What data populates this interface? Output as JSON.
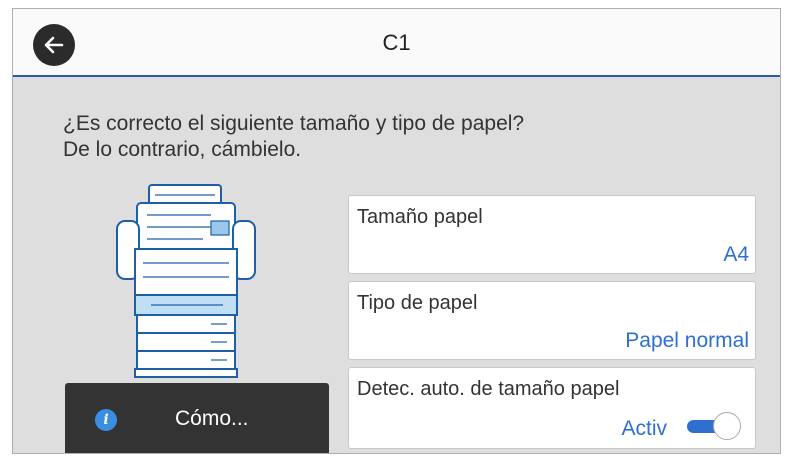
{
  "header": {
    "title": "C1"
  },
  "prompt": {
    "line1": "¿Es correcto el siguiente tamaño y tipo de papel?",
    "line2": "De lo contrario, cámbielo."
  },
  "how_button": {
    "label": "Cómo...",
    "icon": "info-icon"
  },
  "settings": [
    {
      "label": "Tamaño papel",
      "value": "A4"
    },
    {
      "label": "Tipo de papel",
      "value": "Papel normal"
    },
    {
      "label": "Detec. auto. de tamaño papel",
      "value": "Activ",
      "toggle_on": true
    }
  ],
  "colors": {
    "accent": "#2f6fd0",
    "header_rule": "#2a5aa8",
    "panel_bg": "#dedede",
    "dark_button": "#333333"
  }
}
